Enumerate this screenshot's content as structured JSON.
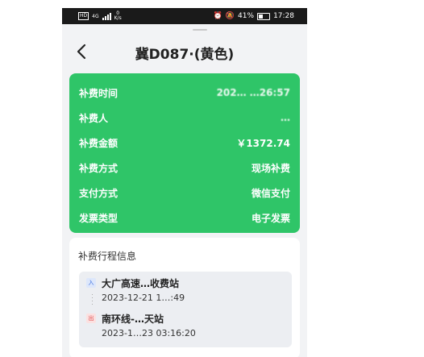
{
  "status_bar": {
    "hd_label": "HD",
    "network_label": "4G",
    "speed_value": "0",
    "speed_unit": "K/s",
    "battery_percent": "41%",
    "time": "17:28"
  },
  "header": {
    "title": "冀D087·(黄色)"
  },
  "fee_details": [
    {
      "label": "补费时间",
      "value": "202… …26:57"
    },
    {
      "label": "补费人",
      "value": "…"
    },
    {
      "label": "补费金额",
      "value": "￥1372.74"
    },
    {
      "label": "补费方式",
      "value": "现场补费"
    },
    {
      "label": "支付方式",
      "value": "微信支付"
    },
    {
      "label": "发票类型",
      "value": "电子发票"
    }
  ],
  "trip": {
    "section_title": "补费行程信息",
    "entry": {
      "tag": "入",
      "station": "大广高速…收费站",
      "time": "2023-12-21 1…:49"
    },
    "exit": {
      "tag": "出",
      "station": "南环线-…天站",
      "time": "2023-1…23 03:16:20"
    }
  },
  "colors": {
    "card_green": "#2fc568",
    "entry_tag": "#3b6fe0",
    "exit_tag": "#e04646"
  }
}
